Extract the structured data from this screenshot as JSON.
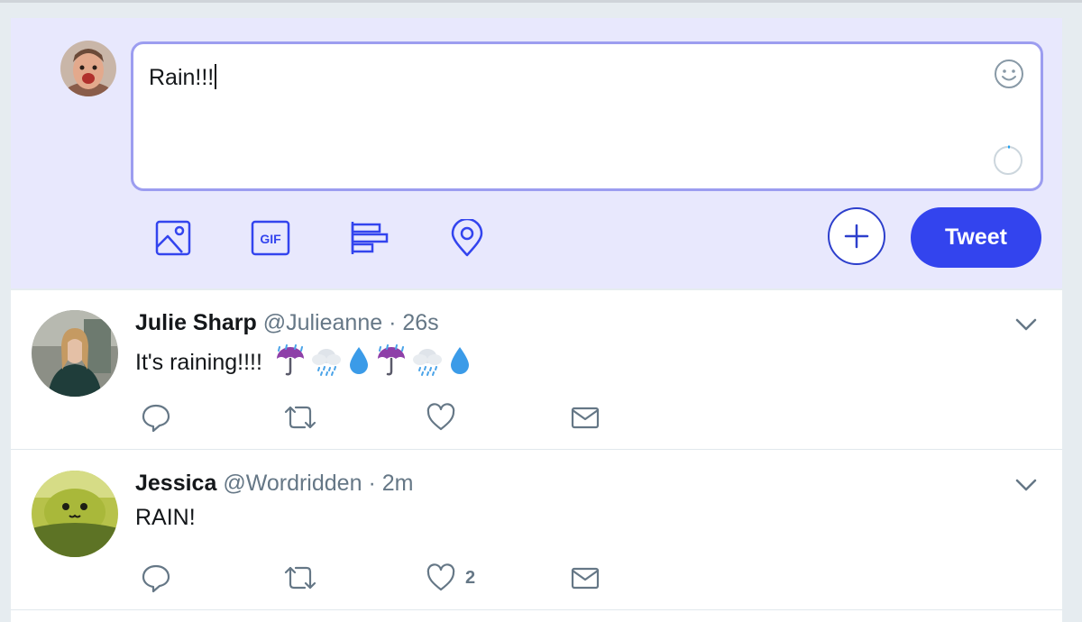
{
  "compose": {
    "text": "Rain!!!",
    "tweet_label": "Tweet",
    "tools": [
      "image-icon",
      "gif-icon",
      "poll-icon",
      "location-icon"
    ],
    "gif_label": "GIF"
  },
  "tweets": [
    {
      "name": "Julie Sharp",
      "handle": "@Julieanne",
      "dot": "·",
      "time": "26s",
      "text": "It's raining!!!!",
      "emojis": [
        "umbrella-with-rain-icon",
        "cloud-with-rain-icon",
        "droplet-icon",
        "umbrella-with-rain-icon",
        "cloud-with-rain-icon",
        "droplet-icon"
      ],
      "likes": ""
    },
    {
      "name": "Jessica",
      "handle": "@Wordridden",
      "dot": "·",
      "time": "2m",
      "text": "RAIN!",
      "emojis": [],
      "likes": "2"
    }
  ],
  "colors": {
    "accent": "#3344ee",
    "compose_bg": "#e8e8fd",
    "box_border": "#9c9df0",
    "secondary_text": "#657786"
  }
}
